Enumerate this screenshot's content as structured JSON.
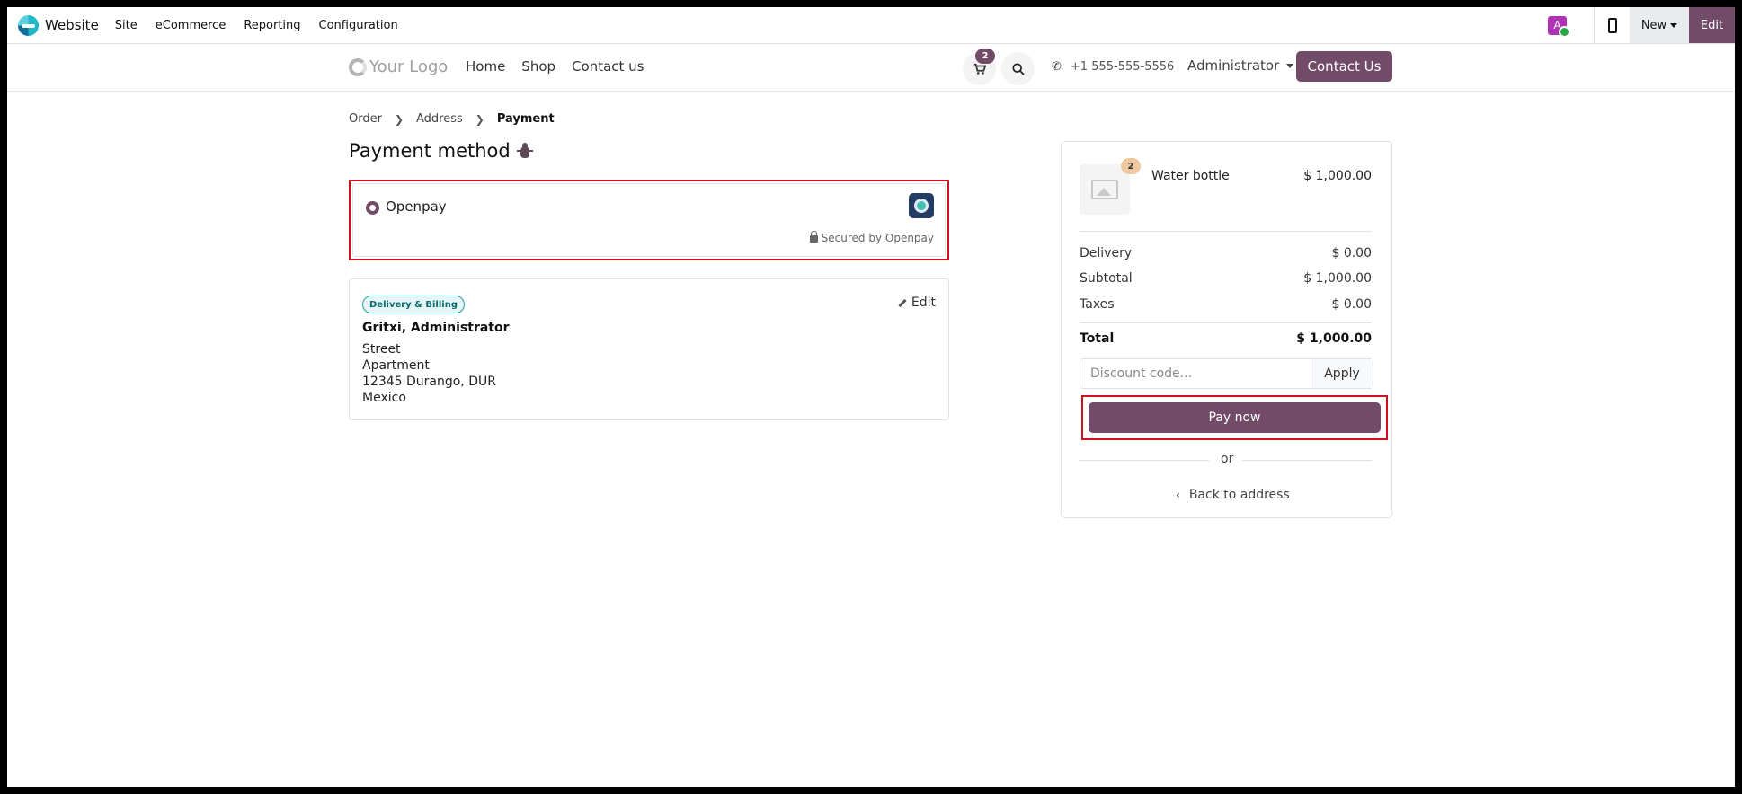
{
  "adminbar": {
    "app_name": "Website",
    "menu": [
      "Site",
      "eCommerce",
      "Reporting",
      "Configuration"
    ],
    "avatar_letter": "A",
    "new_label": "New",
    "edit_label": "Edit"
  },
  "header": {
    "logo_text": "Your Logo",
    "nav": [
      "Home",
      "Shop",
      "Contact us"
    ],
    "cart_count": "2",
    "phone": "+1 555-555-5556",
    "user": "Administrator",
    "contact_button": "Contact Us"
  },
  "breadcrumb": {
    "items": [
      "Order",
      "Address"
    ],
    "current": "Payment"
  },
  "page_title": "Payment method",
  "payment": {
    "option_label": "Openpay",
    "secured_text": "Secured by Openpay"
  },
  "address": {
    "badge": "Delivery & Billing",
    "edit_label": "Edit",
    "name": "Gritxi, Administrator",
    "lines": [
      "Street",
      "Apartment",
      "12345 Durango, DUR",
      "Mexico"
    ]
  },
  "summary": {
    "product": {
      "name": "Water bottle",
      "price": "$ 1,000.00",
      "qty": "2"
    },
    "delivery_label": "Delivery",
    "delivery_value": "$ 0.00",
    "subtotal_label": "Subtotal",
    "subtotal_value": "$ 1,000.00",
    "taxes_label": "Taxes",
    "taxes_value": "$ 0.00",
    "total_label": "Total",
    "total_value": "$ 1,000.00",
    "discount_placeholder": "Discount code...",
    "apply_label": "Apply",
    "pay_label": "Pay now",
    "or_label": "or",
    "back_label": "Back to address"
  },
  "colors": {
    "brand": "#714b67",
    "highlight": "#d0101a"
  }
}
